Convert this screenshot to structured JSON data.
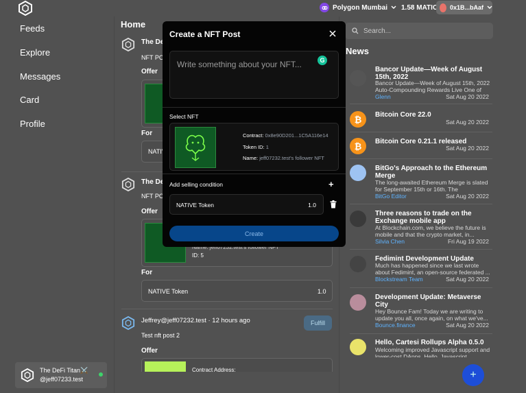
{
  "topbar": {
    "network": "Polygon Mumbai",
    "balance": "1.58 MATIC",
    "account": "0x1B...bAaf"
  },
  "nav": {
    "items": [
      "Feeds",
      "Explore",
      "Messages",
      "Card",
      "Profile"
    ]
  },
  "user": {
    "name": "The DeFi Titan⚔️",
    "handle": "@jeff07233.test"
  },
  "feed": {
    "title": "Home",
    "post1": {
      "author": "The DeFi",
      "text": "NFT POS",
      "offer": "Offer",
      "for": "For",
      "token": "NATIVE"
    },
    "post2": {
      "author": "The Def",
      "text": "NFT POS",
      "offer": "Offer",
      "name_partial": "Name: jeff07232.test's follower NFT",
      "id": "ID: 5",
      "for": "For",
      "token": "NATIVE Token",
      "amount": "1.0"
    },
    "post3": {
      "author": "Jeffrey@jeff07232.test · 12 hours ago",
      "text": "Test nft post 2",
      "offer": "Offer",
      "contract": "Contract Address:",
      "fulfill": "Fulfill"
    }
  },
  "search": {
    "placeholder": "Search..."
  },
  "news": {
    "title": "News",
    "items": [
      {
        "title": "Bancor Update—Week of August 15th, 2022",
        "desc": "Bancor Update—Week of August 15th, 2022 Auto-Compounding Rewards Live One of the...",
        "source": "Glenn",
        "date": "Sat Aug 20 2022"
      },
      {
        "title": "Bitcoin Core 22.0",
        "desc": "",
        "source": "",
        "date": "Sat Aug 20 2022"
      },
      {
        "title": "Bitcoin Core 0.21.1 released",
        "desc": "",
        "source": "",
        "date": "Sat Aug 20 2022"
      },
      {
        "title": "BitGo's Approach to the Ethereum Merge",
        "desc": "The long-awaited Ethereum Merge is slated for September 15th or 16th. The community...",
        "source": "BitGo Editor",
        "date": "Sat Aug 20 2022"
      },
      {
        "title": "Three reasons to trade on the Exchange mobile app",
        "desc": "At Blockchain.com, we believe the future is mobile and that the crypto market, in...",
        "source": "Silvia Chen",
        "date": "Fri Aug 19 2022"
      },
      {
        "title": "Fedimint Development Update",
        "desc": "Much has happened since we last wrote about Fedimint, an open-source federated ...",
        "source": "Blockstream Team",
        "date": "Sat Aug 20 2022"
      },
      {
        "title": "Development Update: Metaverse City",
        "desc": "Hey Bounce Fam! Today we are writing to update you all, once again, on what we've...",
        "source": "Bounce.finance",
        "date": "Sat Aug 20 2022"
      },
      {
        "title": "Hello, Cartesi Rollups Alpha 0.5.0",
        "desc": "Welcoming improved Javascript support and lower-cost DApps. Hello, Javascript",
        "source": "",
        "date": ""
      }
    ],
    "fab": "+"
  },
  "modal": {
    "title": "Create a NFT Post",
    "placeholder": "Write something about your NFT...",
    "grammarly": "G",
    "select_nft": "Select NFT",
    "contract_label": "Contract:",
    "contract_value": "0x8e90D201...1C5A116e14",
    "token_label": "Token ID:",
    "token_value": "1",
    "name_label": "Name:",
    "name_value": "jeff07232.test's follower NFT",
    "selling": "Add selling condition",
    "plus": "+",
    "cond_token": "NATIVE Token",
    "cond_amount": "1.0",
    "create": "Create"
  },
  "colors": {
    "bg": "#515151",
    "modal": "#050505",
    "accent": "#07468a",
    "link": "#5fb3ff",
    "online": "#3ed36b"
  }
}
